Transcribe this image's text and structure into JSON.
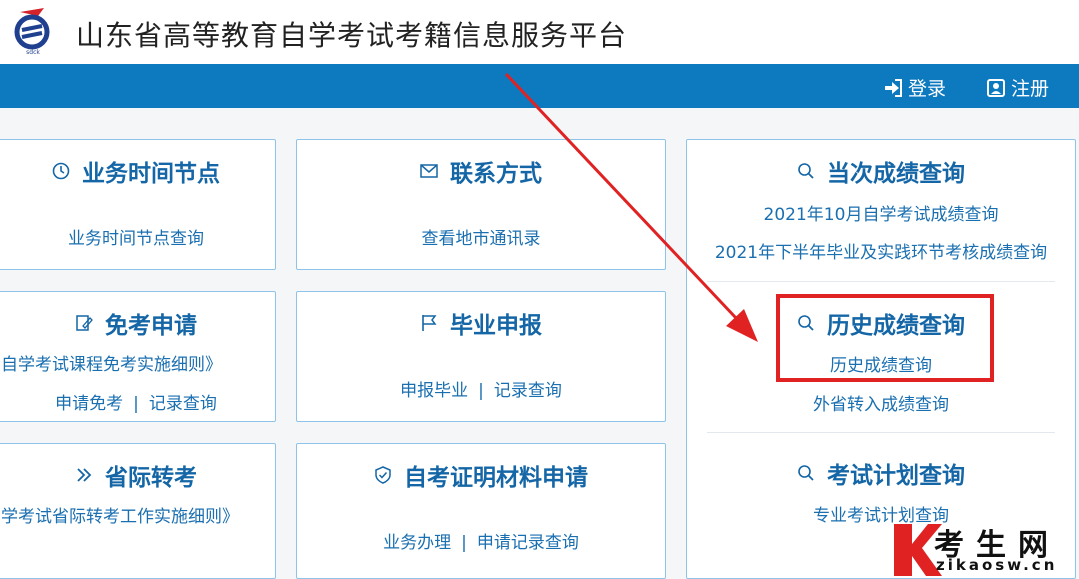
{
  "header": {
    "logo_text": "sdck",
    "title": "山东省高等教育自学考试考籍信息服务平台"
  },
  "nav": {
    "login": "登录",
    "register": "注册"
  },
  "cards": {
    "schedule": {
      "title": "业务时间节点",
      "link": "业务时间节点查询"
    },
    "contact": {
      "title": "联系方式",
      "link": "查看地市通讯录"
    },
    "exemption": {
      "title": "免考申请",
      "rules": "自学考试课程免考实施细则》",
      "apply": "申请免考",
      "sep": "|",
      "records": "记录查询"
    },
    "graduation": {
      "title": "毕业申报",
      "apply": "申报毕业",
      "sep": "|",
      "records": "记录查询"
    },
    "transfer": {
      "title": "省际转考",
      "rules": "学考试省际转考工作实施细则》"
    },
    "certificate": {
      "title": "自考证明材料申请",
      "handle": "业务办理",
      "sep": "|",
      "records": "申请记录查询"
    },
    "scores": {
      "current_title": "当次成绩查询",
      "current_link1": "2021年10月自学考试成绩查询",
      "current_link2": "2021年下半年毕业及实践环节考核成绩查询",
      "history_title": "历史成绩查询",
      "history_link1": "历史成绩查询",
      "history_link2": "外省转入成绩查询",
      "plan_title": "考试计划查询",
      "plan_link": "专业考试计划查询"
    }
  },
  "watermark": {
    "brand": "考生网",
    "url": "zikaosw.cn"
  },
  "colors": {
    "nav_bg": "#0d79bf",
    "title_blue": "#1466a6",
    "link_blue": "#1a6fb0",
    "card_border": "#8ec4e8",
    "annotation_red": "#e02222"
  }
}
